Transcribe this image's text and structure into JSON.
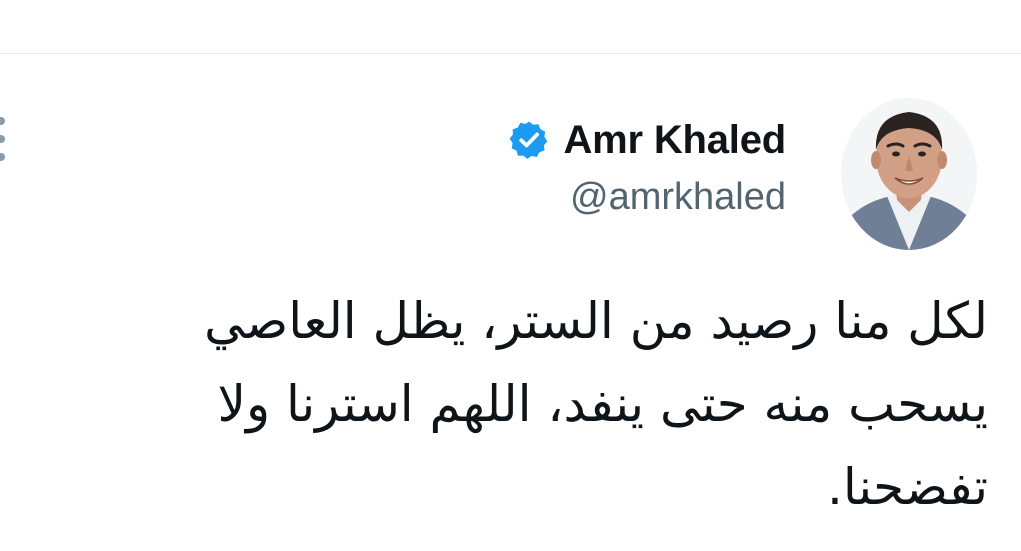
{
  "tweet": {
    "author": {
      "display_name": "Amr Khaled",
      "handle": "@amrkhaled",
      "verified": true,
      "avatar_icon": "profile-photo"
    },
    "text_lines": [
      "لكل منا رصيد من الستر، يظل العاصي",
      "يسحب منه حتى ينفد، اللهم استرنا ولا",
      "تفضحنا."
    ]
  },
  "colors": {
    "verified_badge": "#1d9bf0",
    "handle_text": "#536471",
    "body_text": "#0f1419",
    "divider": "#e6ecf0"
  },
  "icons": {
    "verified": "verified-badge-icon",
    "more": "more-options-icon"
  }
}
